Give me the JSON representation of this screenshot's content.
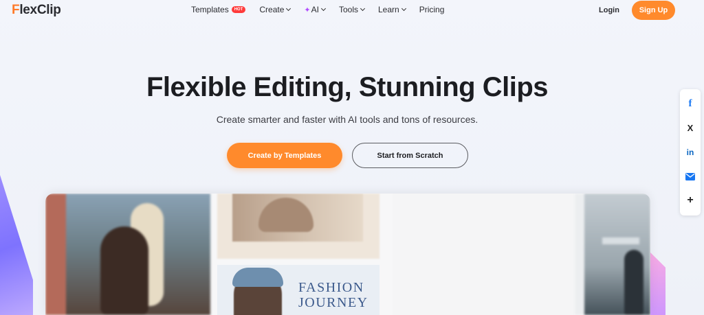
{
  "header": {
    "logo_mark": "F",
    "logo_rest": "lexClip",
    "nav": [
      {
        "label": "Templates",
        "badge": "HOT"
      },
      {
        "label": "Create",
        "has_dropdown": true
      },
      {
        "label": "AI",
        "has_dropdown": true,
        "icon": "sparkle-icon"
      },
      {
        "label": "Tools",
        "has_dropdown": true
      },
      {
        "label": "Learn",
        "has_dropdown": true
      },
      {
        "label": "Pricing"
      }
    ],
    "login": "Login",
    "signup": "Sign Up"
  },
  "hero": {
    "title": "Flexible Editing, Stunning Clips",
    "subtitle": "Create smarter and faster with AI tools and tons of resources.",
    "primary_button": "Create by Templates",
    "secondary_button": "Start from Scratch"
  },
  "social": {
    "items": [
      "facebook-icon",
      "x-icon",
      "linkedin-icon",
      "mail-icon",
      "plus-icon"
    ],
    "glyphs": {
      "facebook": "f",
      "x": "X",
      "linkedin": "in",
      "plus": "+"
    }
  },
  "collage": {
    "fashion_line1": "FASHION",
    "fashion_line2": "JOURNEY"
  },
  "colors": {
    "accent": "#ff8a2c",
    "hot_badge": "#ff3b3b",
    "facebook": "#1877f2",
    "linkedin": "#0a66c2",
    "mail": "#1877f2"
  }
}
